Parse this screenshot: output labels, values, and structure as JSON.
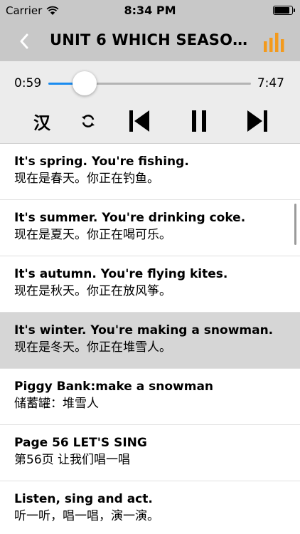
{
  "status_bar": {
    "carrier": "Carrier",
    "time": "8:34 PM",
    "battery_level": 0.9
  },
  "nav": {
    "title": "UNIT 6  WHICH SEASON...",
    "back_icon": "chevron-left-icon",
    "menu_icon": "equalizer-icon",
    "accent": "#f39a1d"
  },
  "player": {
    "current_time": "0:59",
    "total_time": "7:47",
    "progress": 0.18,
    "accent": "#1a8cf0",
    "han_label": "汉"
  },
  "list": {
    "selected_index": 3,
    "items": [
      {
        "en": "It's spring. You're fishing.",
        "zh": "现在是春天。你正在钓鱼。"
      },
      {
        "en": "It's summer. You're drinking coke.",
        "zh": "现在是夏天。你正在喝可乐。"
      },
      {
        "en": "It's autumn. You're flying kites.",
        "zh": "现在是秋天。你正在放风筝。"
      },
      {
        "en": "It's winter. You're making a snowman.",
        "zh": "现在是冬天。你正在堆雪人。"
      },
      {
        "en": "Piggy Bank:make a snowman",
        "zh": "储蓄罐：堆雪人"
      },
      {
        "en": "Page 56  LET'S SING",
        "zh": "第56页 让我们唱一唱"
      },
      {
        "en": "Listen, sing and act.",
        "zh": "听一听，唱一唱，演一演。"
      }
    ]
  }
}
